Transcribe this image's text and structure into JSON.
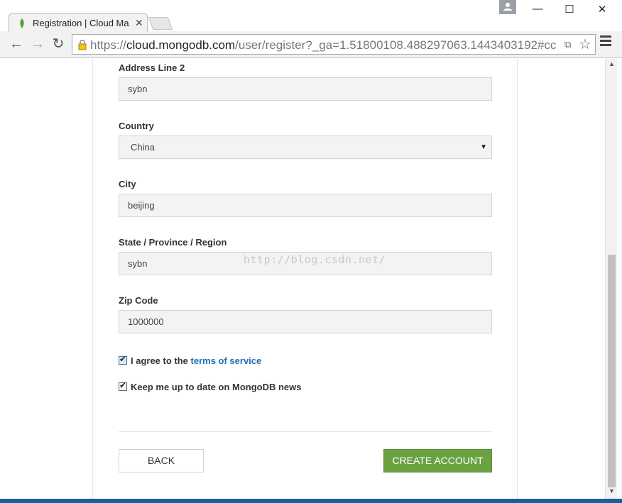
{
  "browser": {
    "tab_title": "Registration | Cloud Ma",
    "url_prefix": "https://",
    "url_host": "cloud.mongodb.com",
    "url_path": "/user/register?_ga=1.51800108.488297063.1443403192#cc",
    "window_controls": {
      "minimize": "—",
      "maximize": "☐",
      "close": "✕"
    },
    "icons": {
      "back": "arrow-left-icon",
      "forward": "arrow-right-icon",
      "reload": "reload-icon",
      "star": "star-icon",
      "menu": "hamburger-icon"
    }
  },
  "form": {
    "address_line2": {
      "label": "Address Line 2",
      "value": "sybn"
    },
    "country": {
      "label": "Country",
      "value": "China"
    },
    "city": {
      "label": "City",
      "value": "beijing"
    },
    "state": {
      "label": "State / Province / Region",
      "value": "sybn"
    },
    "zip": {
      "label": "Zip Code",
      "value": "1000000"
    },
    "agree": {
      "prefix": "I agree to the ",
      "link": "terms of service",
      "checked": true
    },
    "news": {
      "label": "Keep me up to date on MongoDB news",
      "checked": true
    }
  },
  "buttons": {
    "back": "BACK",
    "create": "CREATE ACCOUNT"
  },
  "watermark": "http://blog.csdn.net/",
  "colors": {
    "create_button": "#6aa241",
    "link": "#1f6fb2"
  }
}
